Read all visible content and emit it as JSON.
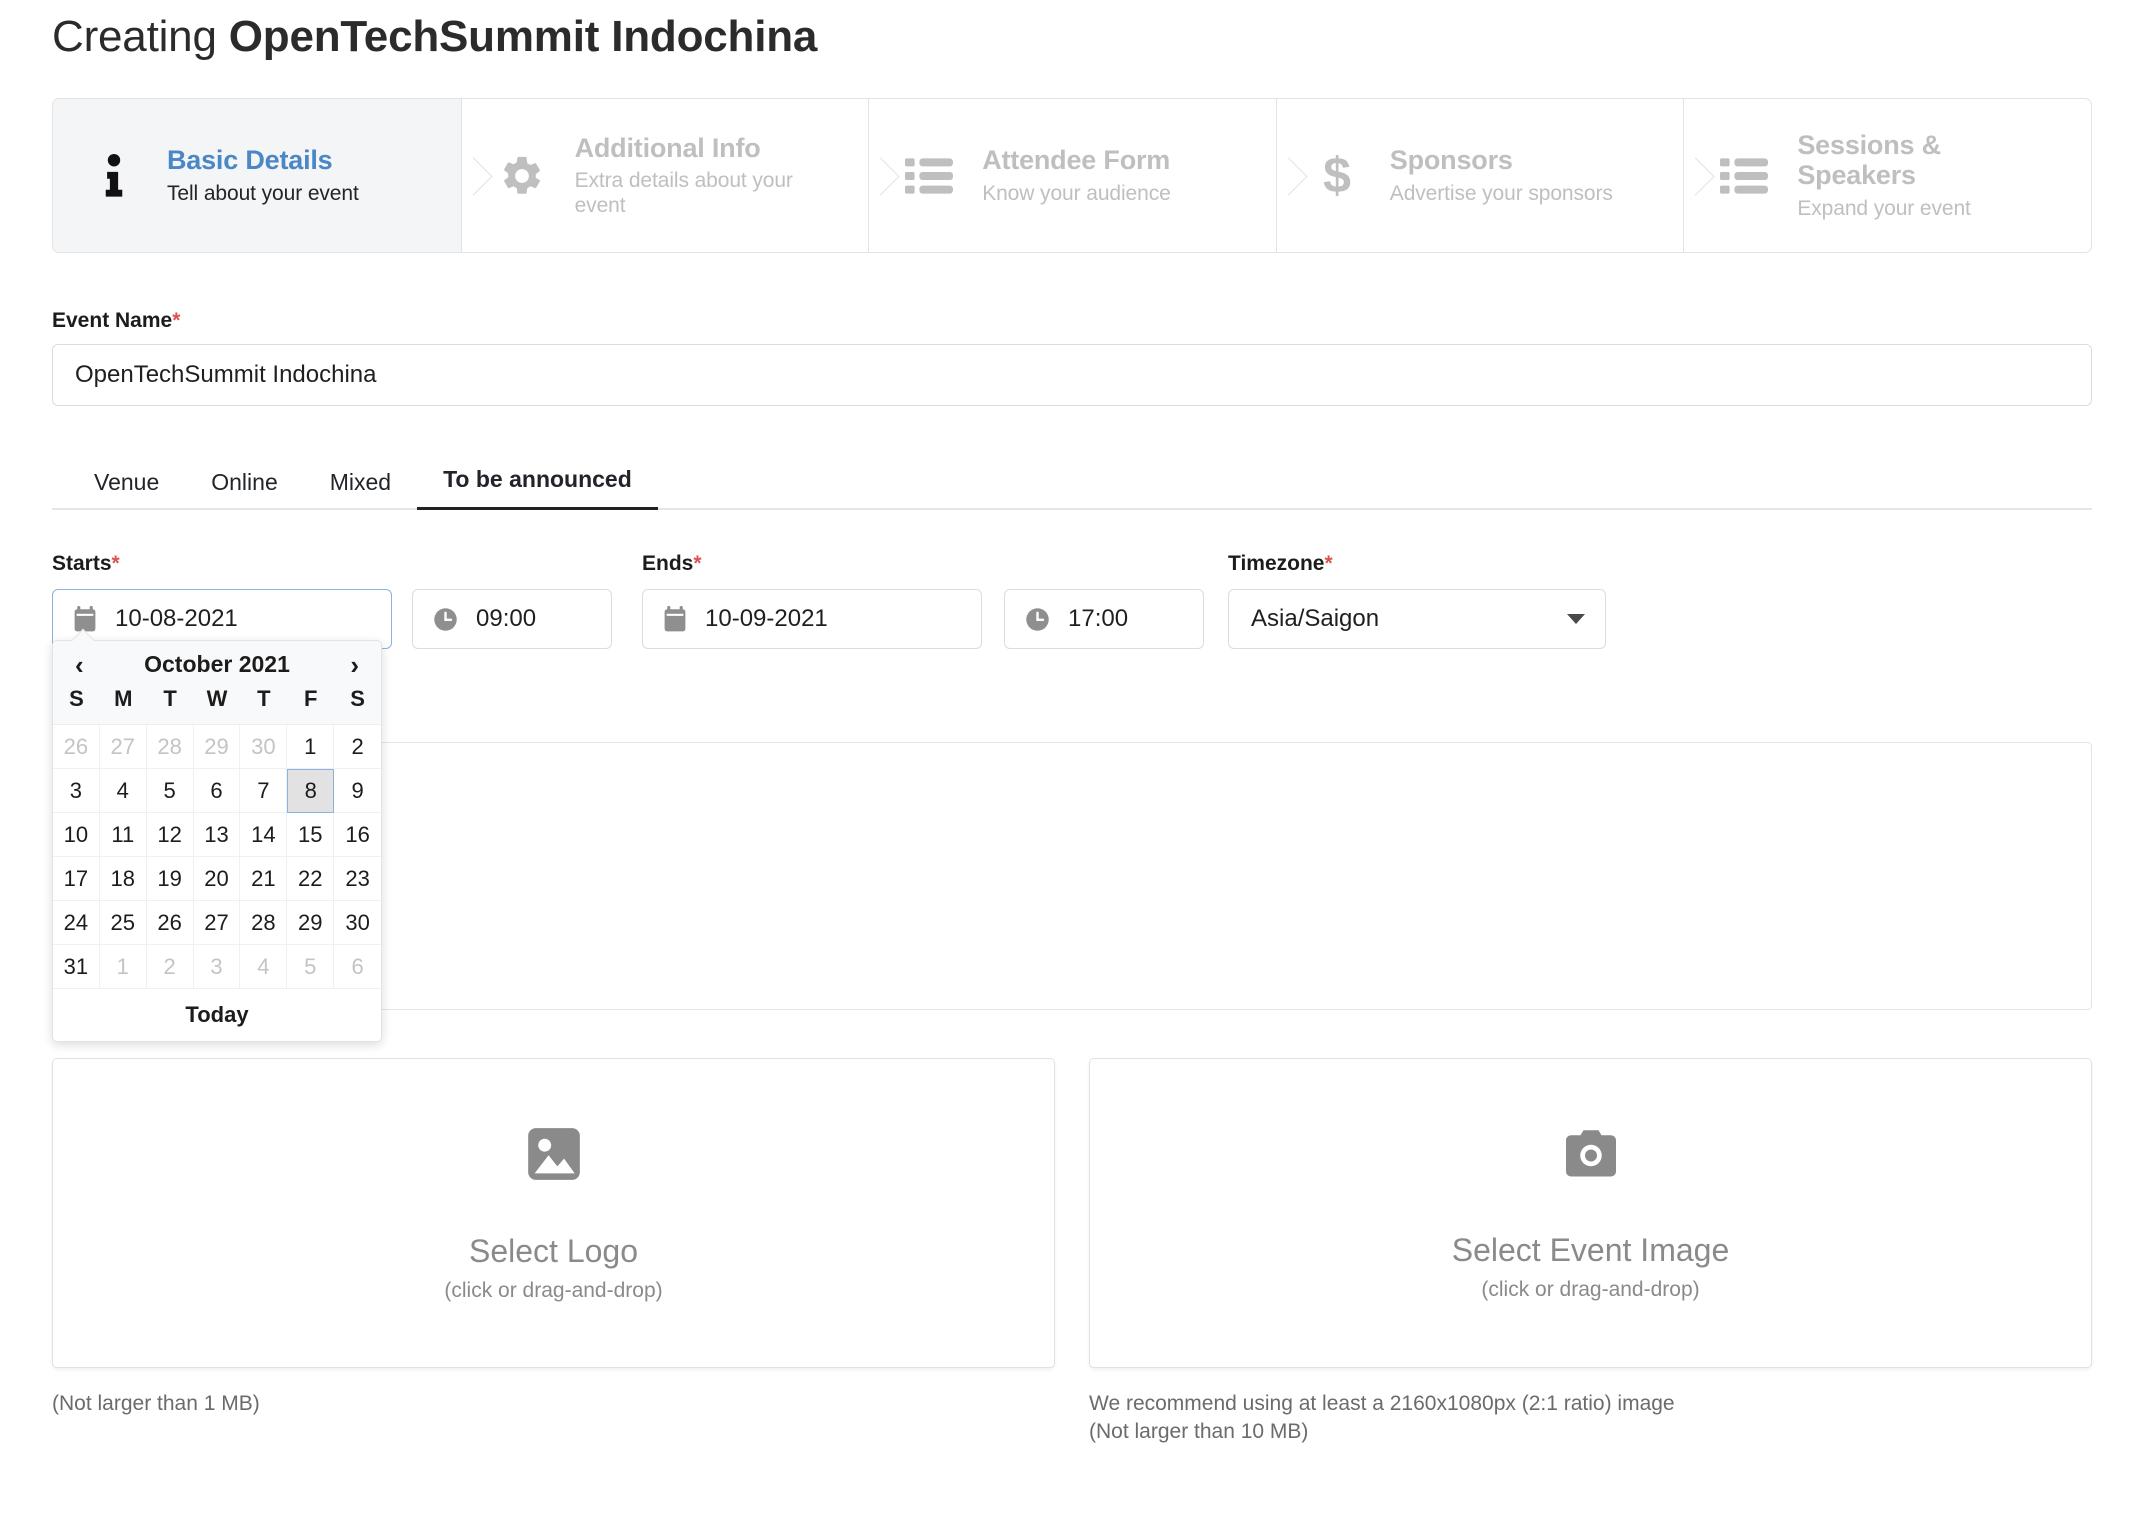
{
  "header": {
    "prefix": "Creating ",
    "event_name": "OpenTechSummit Indochina"
  },
  "steps": [
    {
      "title": "Basic Details",
      "subtitle": "Tell about your event",
      "icon": "info-icon",
      "active": true
    },
    {
      "title": "Additional Info",
      "subtitle": "Extra details about your event",
      "icon": "gear-icon",
      "active": false
    },
    {
      "title": "Attendee Form",
      "subtitle": "Know your audience",
      "icon": "list-icon",
      "active": false
    },
    {
      "title": "Sponsors",
      "subtitle": "Advertise your sponsors",
      "icon": "dollar-icon",
      "active": false
    },
    {
      "title": "Sessions & Speakers",
      "subtitle": "Expand your event",
      "icon": "list-icon",
      "active": false
    }
  ],
  "event_name_field": {
    "label": "Event Name",
    "required_mark": "*",
    "value": "OpenTechSummit Indochina"
  },
  "location_tabs": [
    {
      "label": "Venue",
      "active": false
    },
    {
      "label": "Online",
      "active": false
    },
    {
      "label": "Mixed",
      "active": false
    },
    {
      "label": "To be announced",
      "active": true
    }
  ],
  "datetime": {
    "starts_label": "Starts",
    "ends_label": "Ends",
    "timezone_label": "Timezone",
    "required_mark": "*",
    "start_date": "10-08-2021",
    "start_time": "09:00",
    "end_date": "10-09-2021",
    "end_time": "17:00",
    "timezone": "Asia/Saigon",
    "calendar_icon": "calendar-icon",
    "clock_icon": "clock-icon",
    "caret_icon": "chevron-down-icon"
  },
  "datepicker": {
    "month_label": "October 2021",
    "prev_label": "‹",
    "next_label": "›",
    "today_label": "Today",
    "weekdays": [
      "S",
      "M",
      "T",
      "W",
      "T",
      "F",
      "S"
    ],
    "weeks": [
      [
        {
          "d": "26",
          "muted": true,
          "selected": false
        },
        {
          "d": "27",
          "muted": true,
          "selected": false
        },
        {
          "d": "28",
          "muted": true,
          "selected": false
        },
        {
          "d": "29",
          "muted": true,
          "selected": false
        },
        {
          "d": "30",
          "muted": true,
          "selected": false
        },
        {
          "d": "1",
          "muted": false,
          "selected": false
        },
        {
          "d": "2",
          "muted": false,
          "selected": false
        }
      ],
      [
        {
          "d": "3",
          "muted": false,
          "selected": false
        },
        {
          "d": "4",
          "muted": false,
          "selected": false
        },
        {
          "d": "5",
          "muted": false,
          "selected": false
        },
        {
          "d": "6",
          "muted": false,
          "selected": false
        },
        {
          "d": "7",
          "muted": false,
          "selected": false
        },
        {
          "d": "8",
          "muted": false,
          "selected": true
        },
        {
          "d": "9",
          "muted": false,
          "selected": false
        }
      ],
      [
        {
          "d": "10",
          "muted": false,
          "selected": false
        },
        {
          "d": "11",
          "muted": false,
          "selected": false
        },
        {
          "d": "12",
          "muted": false,
          "selected": false
        },
        {
          "d": "13",
          "muted": false,
          "selected": false
        },
        {
          "d": "14",
          "muted": false,
          "selected": false
        },
        {
          "d": "15",
          "muted": false,
          "selected": false
        },
        {
          "d": "16",
          "muted": false,
          "selected": false
        }
      ],
      [
        {
          "d": "17",
          "muted": false,
          "selected": false
        },
        {
          "d": "18",
          "muted": false,
          "selected": false
        },
        {
          "d": "19",
          "muted": false,
          "selected": false
        },
        {
          "d": "20",
          "muted": false,
          "selected": false
        },
        {
          "d": "21",
          "muted": false,
          "selected": false
        },
        {
          "d": "22",
          "muted": false,
          "selected": false
        },
        {
          "d": "23",
          "muted": false,
          "selected": false
        }
      ],
      [
        {
          "d": "24",
          "muted": false,
          "selected": false
        },
        {
          "d": "25",
          "muted": false,
          "selected": false
        },
        {
          "d": "26",
          "muted": false,
          "selected": false
        },
        {
          "d": "27",
          "muted": false,
          "selected": false
        },
        {
          "d": "28",
          "muted": false,
          "selected": false
        },
        {
          "d": "29",
          "muted": false,
          "selected": false
        },
        {
          "d": "30",
          "muted": false,
          "selected": false
        }
      ],
      [
        {
          "d": "31",
          "muted": false,
          "selected": false
        },
        {
          "d": "1",
          "muted": true,
          "selected": false
        },
        {
          "d": "2",
          "muted": true,
          "selected": false
        },
        {
          "d": "3",
          "muted": true,
          "selected": false
        },
        {
          "d": "4",
          "muted": true,
          "selected": false
        },
        {
          "d": "5",
          "muted": true,
          "selected": false
        },
        {
          "d": "6",
          "muted": true,
          "selected": false
        }
      ]
    ]
  },
  "editor": {
    "toolbar_groups": [
      {
        "buttons": [
          {
            "icon": "redo-icon"
          },
          {
            "icon": "line-break-icon"
          }
        ]
      },
      {
        "buttons": [
          {
            "icon": "link-icon"
          }
        ]
      }
    ],
    "body_value": ""
  },
  "uploads": [
    {
      "icon": "image-icon",
      "title": "Select Logo",
      "subtitle": "(click or drag-and-drop)",
      "note": "(Not larger than 1 MB)"
    },
    {
      "icon": "camera-icon",
      "title": "Select Event Image",
      "subtitle": "(click or drag-and-drop)",
      "note": "We recommend using at least a 2160x1080px (2:1 ratio) image\n(Not larger than 10 MB)"
    }
  ],
  "colors": {
    "accent_blue": "#4a87c7",
    "required_red": "#d9534f",
    "muted_gray": "#bfbfbf",
    "focus_border": "#8ab4dd"
  }
}
